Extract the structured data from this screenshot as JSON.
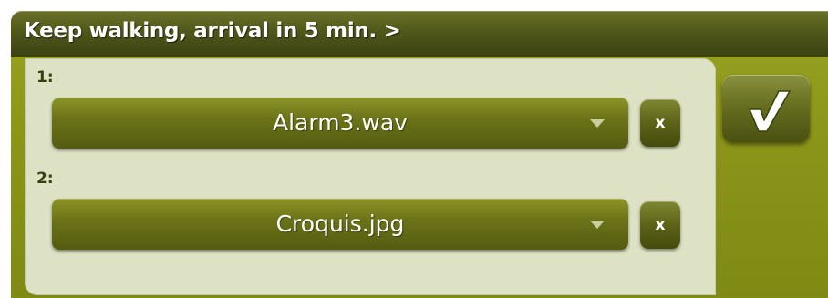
{
  "header": {
    "title": "Keep walking, arrival in 5 min. >"
  },
  "fields": [
    {
      "label": "1:",
      "value": "Alarm3.wav",
      "clear_label": "x"
    },
    {
      "label": "2:",
      "value": "Croquis.jpg",
      "clear_label": "x"
    }
  ],
  "icons": {
    "dropdown_arrow": "chevron-down-icon",
    "confirm": "checkmark-icon"
  },
  "colors": {
    "title_bar": "#50571a",
    "frame": "#8c9619",
    "panel": "#dde2c4",
    "button": "#6c7419",
    "text_light": "#ffffff",
    "label_dark": "#3a3f10"
  }
}
